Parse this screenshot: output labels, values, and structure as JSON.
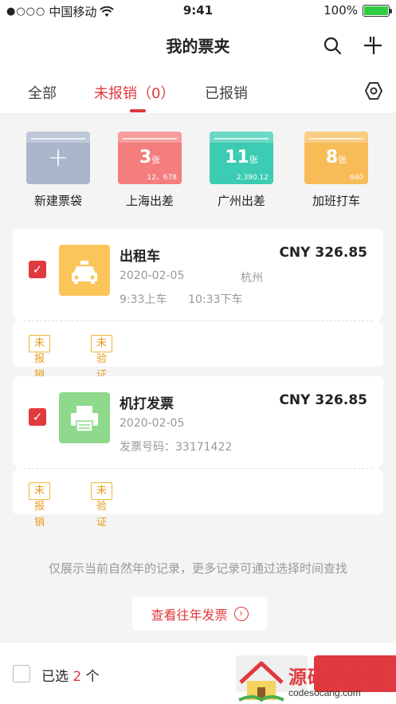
{
  "status_bar": {
    "carrier": "中国移动",
    "signal_dots": "●○○○",
    "time": "9:41",
    "battery_pct": "100%",
    "battery_color": "#2ecc40"
  },
  "nav": {
    "title": "我的票夹",
    "search_icon": "search-icon",
    "add_icon": "plus-icon"
  },
  "tabs": [
    {
      "label": "全部",
      "active": false
    },
    {
      "label": "未报销（0）",
      "active": true
    },
    {
      "label": "已报销",
      "active": false
    }
  ],
  "accent_color": "#e0393e",
  "folders": [
    {
      "label": "新建票袋",
      "color": "#a9b6cc",
      "icon": "plus-icon"
    },
    {
      "label": "上海出差",
      "color": "#f47d7d",
      "count": "3",
      "unit": "张",
      "amount": "12，678"
    },
    {
      "label": "广州出差",
      "color": "#3ccbb3",
      "count": "11",
      "unit": "张",
      "amount": "2,390.12"
    },
    {
      "label": "加班打车",
      "color": "#f7bb58",
      "count": "8",
      "unit": "张",
      "amount": "640"
    }
  ],
  "cards": [
    {
      "name": "出租车",
      "price": "CNY 326.85",
      "date": "2020-02-05",
      "city": "杭州",
      "times": "9:33上车      10:33下车",
      "icon": "taxi-icon",
      "icon_color": "#fbc55a",
      "badges": [
        "未报销",
        "未验证"
      ]
    },
    {
      "name": "机打发票",
      "price": "CNY 326.85",
      "date": "2020-02-05",
      "extra": "发票号码：33171422",
      "icon": "printer-icon",
      "icon_color": "#8ed98b",
      "badges": [
        "未报销",
        "未验证"
      ]
    }
  ],
  "footer_note": "仅展示当前自然年的记录，更多记录可通过选择时间查找",
  "history_button": "查看往年发票",
  "bottom": {
    "selected_prefix": "已选",
    "selected_count": "2",
    "selected_suffix": "个"
  },
  "watermark": {
    "title": "源码搜藏网",
    "url": "codesocang.com"
  }
}
